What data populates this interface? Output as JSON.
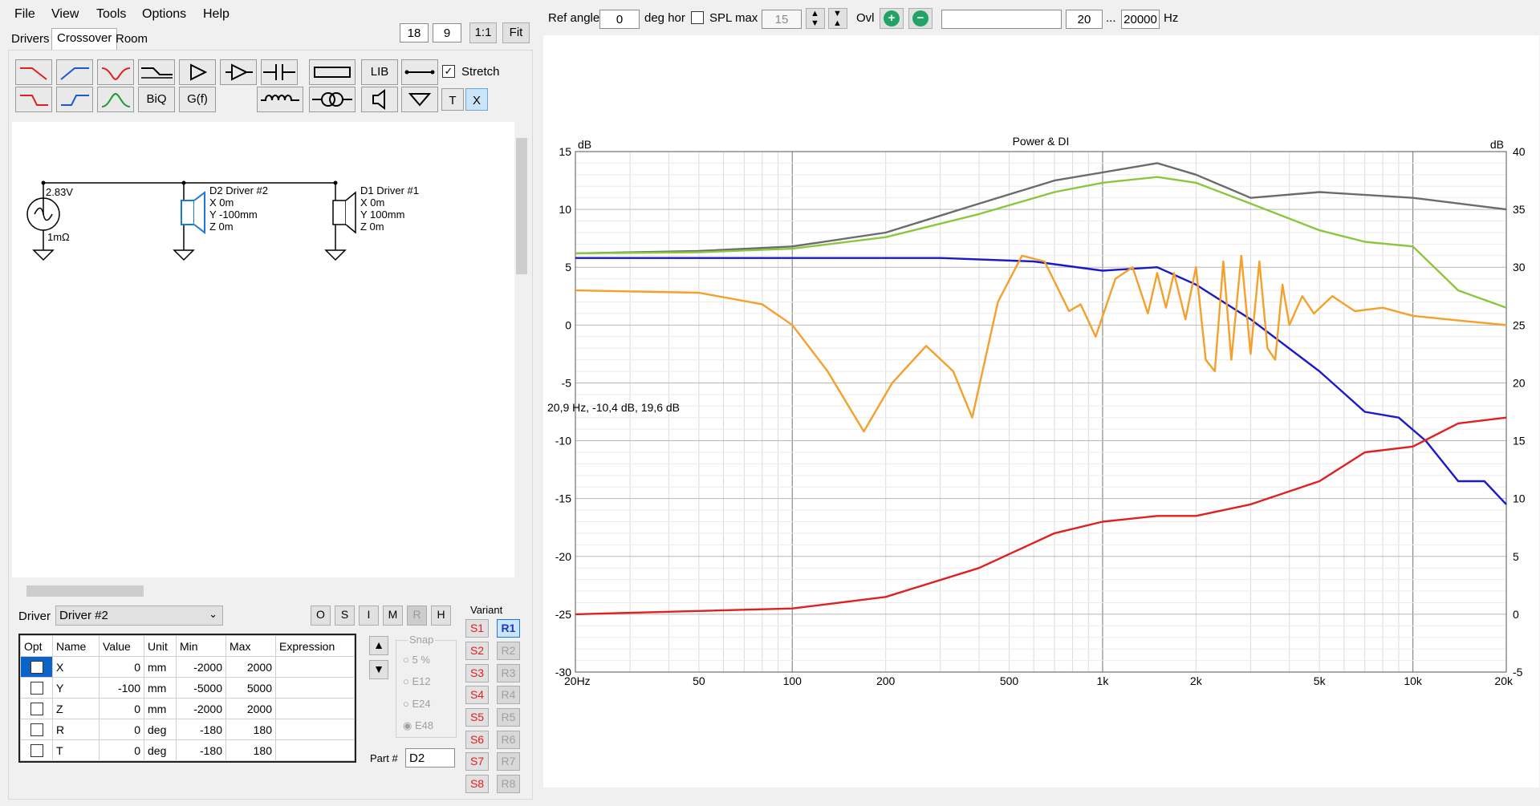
{
  "menu": [
    "File",
    "View",
    "Tools",
    "Options",
    "Help"
  ],
  "zoom": {
    "a": "18",
    "b": "9",
    "one_to_one": "1:1",
    "fit": "Fit"
  },
  "tabs": [
    "Drivers",
    "Crossover",
    "Room"
  ],
  "palette": {
    "biq": "BiQ",
    "gf": "G(f)",
    "lib": "LIB",
    "t": "T",
    "x": "X",
    "stretch": "Stretch"
  },
  "schematic": {
    "source_voltage": "2.83V",
    "source_res": "1mΩ",
    "d2": {
      "title": "D2 Driver #2",
      "x": "X 0m",
      "y": "Y -100mm",
      "z": "Z 0m"
    },
    "d1": {
      "title": "D1 Driver #1",
      "x": "X 0m",
      "y": "Y 100mm",
      "z": "Z 0m"
    }
  },
  "driver_select": {
    "label": "Driver",
    "value": "Driver #2"
  },
  "mode_buttons": [
    "O",
    "S",
    "I",
    "M",
    "R",
    "H"
  ],
  "params": {
    "headers": [
      "Opt",
      "Name",
      "Value",
      "Unit",
      "Min",
      "Max",
      "Expression"
    ],
    "rows": [
      {
        "name": "X",
        "value": "0",
        "unit": "mm",
        "min": "-2000",
        "max": "2000"
      },
      {
        "name": "Y",
        "value": "-100",
        "unit": "mm",
        "min": "-5000",
        "max": "5000"
      },
      {
        "name": "Z",
        "value": "0",
        "unit": "mm",
        "min": "-2000",
        "max": "2000"
      },
      {
        "name": "R",
        "value": "0",
        "unit": "deg",
        "min": "-180",
        "max": "180"
      },
      {
        "name": "T",
        "value": "0",
        "unit": "deg",
        "min": "-180",
        "max": "180"
      }
    ]
  },
  "snap": {
    "label": "Snap",
    "options": [
      "5 %",
      "E12",
      "E24",
      "E48"
    ]
  },
  "part": {
    "label": "Part #",
    "value": "D2"
  },
  "variant": {
    "label": "Variant",
    "s": [
      "S1",
      "S2",
      "S3",
      "S4",
      "S5",
      "S6",
      "S7",
      "S8"
    ],
    "r": [
      "R1",
      "R2",
      "R3",
      "R4",
      "R5",
      "R6",
      "R7",
      "R8"
    ]
  },
  "top_toolbar": {
    "ref_angle_label": "Ref angle",
    "ref_angle_value": "0",
    "deg_hor": "deg hor",
    "spl_max_label": "SPL max",
    "spl_max_value": "15",
    "ovl": "Ovl",
    "freq_from": "20",
    "freq_dots": "...",
    "freq_to": "20000",
    "hz": "Hz"
  },
  "chart_cursor_readout": "20,9 Hz, -10,4 dB, 19,6 dB",
  "colors": {
    "dark_gray": "#6b6b6b",
    "green": "#8cc63f",
    "blue": "#1a1acd",
    "orange": "#f5a02a",
    "red": "#e02020"
  },
  "chart_data": {
    "type": "line",
    "title": "Power & DI",
    "ylabel_left": "dB",
    "ylabel_right": "dB",
    "xscale": "log",
    "xlim": [
      20,
      20000
    ],
    "ylim_left": [
      -30,
      15
    ],
    "ylim_right": [
      -5,
      40
    ],
    "x_ticks": [
      {
        "v": 20,
        "label": "20Hz"
      },
      {
        "v": 50,
        "label": "50"
      },
      {
        "v": 100,
        "label": "100"
      },
      {
        "v": 200,
        "label": "200"
      },
      {
        "v": 500,
        "label": "500"
      },
      {
        "v": 1000,
        "label": "1k"
      },
      {
        "v": 2000,
        "label": "2k"
      },
      {
        "v": 5000,
        "label": "5k"
      },
      {
        "v": 10000,
        "label": "10k"
      },
      {
        "v": 20000,
        "label": "20k"
      }
    ],
    "y_ticks_left": [
      15,
      10,
      5,
      0,
      -5,
      -10,
      -15,
      -20,
      -25,
      -30
    ],
    "y_ticks_right": [
      40,
      35,
      30,
      25,
      20,
      15,
      10,
      5,
      0,
      -5
    ],
    "grid": true,
    "series": [
      {
        "color": "#6b6b6b",
        "axis": "left",
        "points": [
          [
            20,
            6.2
          ],
          [
            50,
            6.4
          ],
          [
            100,
            6.8
          ],
          [
            200,
            8
          ],
          [
            400,
            10.5
          ],
          [
            700,
            12.5
          ],
          [
            1000,
            13.2
          ],
          [
            1500,
            14
          ],
          [
            2000,
            13
          ],
          [
            3000,
            11
          ],
          [
            5000,
            11.5
          ],
          [
            10000,
            11
          ],
          [
            20000,
            10
          ]
        ]
      },
      {
        "color": "#8cc63f",
        "axis": "left",
        "points": [
          [
            20,
            6.2
          ],
          [
            50,
            6.3
          ],
          [
            100,
            6.6
          ],
          [
            200,
            7.6
          ],
          [
            400,
            9.6
          ],
          [
            700,
            11.5
          ],
          [
            1000,
            12.3
          ],
          [
            1500,
            12.8
          ],
          [
            2000,
            12.3
          ],
          [
            3000,
            10.5
          ],
          [
            5000,
            8.2
          ],
          [
            7000,
            7.2
          ],
          [
            10000,
            6.8
          ],
          [
            14000,
            3
          ],
          [
            20000,
            1.5
          ]
        ]
      },
      {
        "color": "#1a1acd",
        "axis": "left",
        "points": [
          [
            20,
            5.8
          ],
          [
            100,
            5.8
          ],
          [
            300,
            5.8
          ],
          [
            600,
            5.5
          ],
          [
            1000,
            4.7
          ],
          [
            1500,
            5
          ],
          [
            2000,
            3.5
          ],
          [
            3000,
            0.5
          ],
          [
            5000,
            -4
          ],
          [
            7000,
            -7.5
          ],
          [
            9000,
            -8
          ],
          [
            11000,
            -10
          ],
          [
            14000,
            -13.5
          ],
          [
            17000,
            -13.5
          ],
          [
            20000,
            -15.5
          ]
        ]
      },
      {
        "color": "#f5a02a",
        "axis": "left",
        "points": [
          [
            20,
            3
          ],
          [
            50,
            2.8
          ],
          [
            80,
            1.8
          ],
          [
            100,
            0
          ],
          [
            130,
            -4
          ],
          [
            170,
            -9.2
          ],
          [
            210,
            -5
          ],
          [
            270,
            -1.8
          ],
          [
            330,
            -4
          ],
          [
            380,
            -8
          ],
          [
            460,
            2
          ],
          [
            550,
            6
          ],
          [
            650,
            5.5
          ],
          [
            780,
            1.2
          ],
          [
            850,
            1.8
          ],
          [
            950,
            -1
          ],
          [
            1100,
            4
          ],
          [
            1250,
            5
          ],
          [
            1400,
            1
          ],
          [
            1500,
            4.5
          ],
          [
            1600,
            1.5
          ],
          [
            1700,
            4.5
          ],
          [
            1850,
            0.5
          ],
          [
            2000,
            5
          ],
          [
            2150,
            -3
          ],
          [
            2300,
            -4
          ],
          [
            2450,
            5.5
          ],
          [
            2600,
            -3
          ],
          [
            2800,
            6
          ],
          [
            3000,
            -2.5
          ],
          [
            3200,
            5.5
          ],
          [
            3400,
            -2
          ],
          [
            3600,
            -3
          ],
          [
            3800,
            3.5
          ],
          [
            4000,
            0
          ],
          [
            4400,
            2.5
          ],
          [
            4800,
            1
          ],
          [
            5500,
            2.5
          ],
          [
            6500,
            1.2
          ],
          [
            8000,
            1.5
          ],
          [
            10000,
            0.8
          ],
          [
            14000,
            0.4
          ],
          [
            20000,
            0
          ]
        ]
      },
      {
        "color": "#e02020",
        "axis": "right",
        "points": [
          [
            20,
            0
          ],
          [
            100,
            0.5
          ],
          [
            200,
            1.5
          ],
          [
            400,
            4
          ],
          [
            700,
            7
          ],
          [
            1000,
            8
          ],
          [
            1500,
            8.5
          ],
          [
            2000,
            8.5
          ],
          [
            3000,
            9.5
          ],
          [
            5000,
            11.5
          ],
          [
            7000,
            14
          ],
          [
            10000,
            14.5
          ],
          [
            14000,
            16.5
          ],
          [
            20000,
            17
          ]
        ]
      }
    ]
  }
}
